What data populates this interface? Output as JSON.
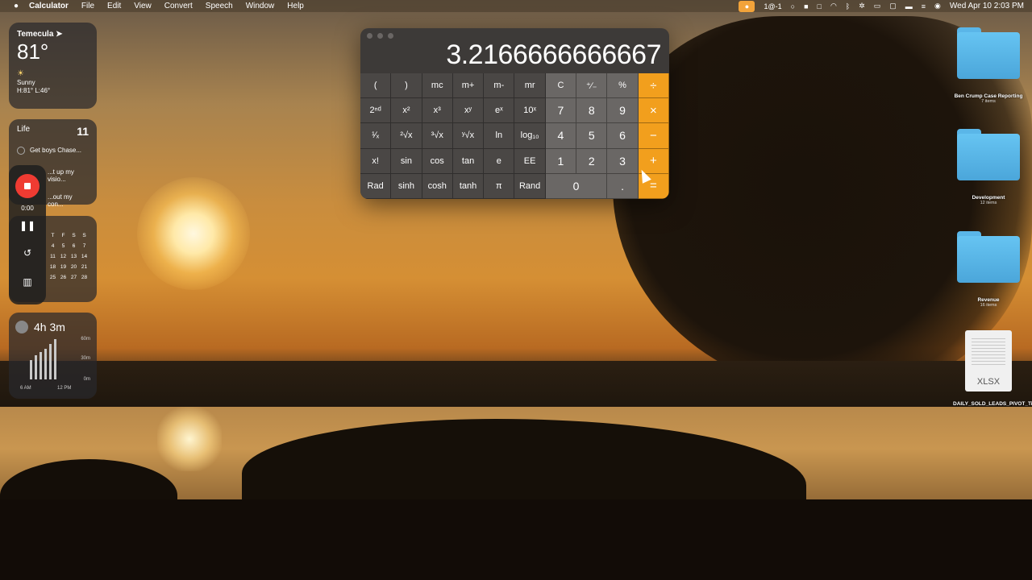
{
  "menubar": {
    "app_name": "Calculator",
    "menus": [
      "File",
      "Edit",
      "View",
      "Convert",
      "Speech",
      "Window",
      "Help"
    ],
    "datetime": "Wed Apr 10  2:03 PM",
    "status_text": "1@-1"
  },
  "weather": {
    "city": "Temecula",
    "temperature": "81°",
    "condition": "Sunny",
    "high_low": "H:81° L:46°"
  },
  "reminders": {
    "list_name": "Life",
    "count": "11",
    "items": [
      "Get boys Chase...",
      "...t up my visio...",
      "...out my con..."
    ]
  },
  "calendar": {
    "weekday_headers": [
      "T",
      "F",
      "S",
      "S"
    ],
    "rows": [
      [
        "4",
        "5",
        "6",
        "7"
      ],
      [
        "11",
        "12",
        "13",
        "14"
      ],
      [
        "18",
        "19",
        "20",
        "21"
      ],
      [
        "25",
        "26",
        "27",
        "28"
      ]
    ]
  },
  "screen_time": {
    "total": "4h 3m",
    "y_labels": [
      "60m",
      "30m",
      "0m"
    ],
    "x_labels": [
      "6 AM",
      "12 PM"
    ]
  },
  "recording": {
    "elapsed": "0:00"
  },
  "calculator": {
    "display": "3.2166666666667",
    "keys": [
      [
        "(",
        ")",
        "mc",
        "m+",
        "m-",
        "mr",
        "C",
        "⁺∕₋",
        "%",
        "÷"
      ],
      [
        "2ⁿᵈ",
        "x²",
        "x³",
        "xʸ",
        "eˣ",
        "10ˣ",
        "7",
        "8",
        "9",
        "×"
      ],
      [
        "¹∕ₓ",
        "²√x",
        "³√x",
        "ʸ√x",
        "ln",
        "log₁₀",
        "4",
        "5",
        "6",
        "−"
      ],
      [
        "x!",
        "sin",
        "cos",
        "tan",
        "e",
        "EE",
        "1",
        "2",
        "3",
        "+"
      ],
      [
        "Rad",
        "sinh",
        "cosh",
        "tanh",
        "π",
        "Rand",
        "0",
        ".",
        "="
      ]
    ]
  },
  "desktop": [
    {
      "label": "Ben Crump Case Reporting",
      "sub": "7 items"
    },
    {
      "label": "Development",
      "sub": "12 items"
    },
    {
      "label": "Revenue",
      "sub": "16 items"
    },
    {
      "label": "DAILY_SOLD_LEADS_PIVOT_TikTok.xlsx",
      "ext": "XLSX"
    }
  ]
}
